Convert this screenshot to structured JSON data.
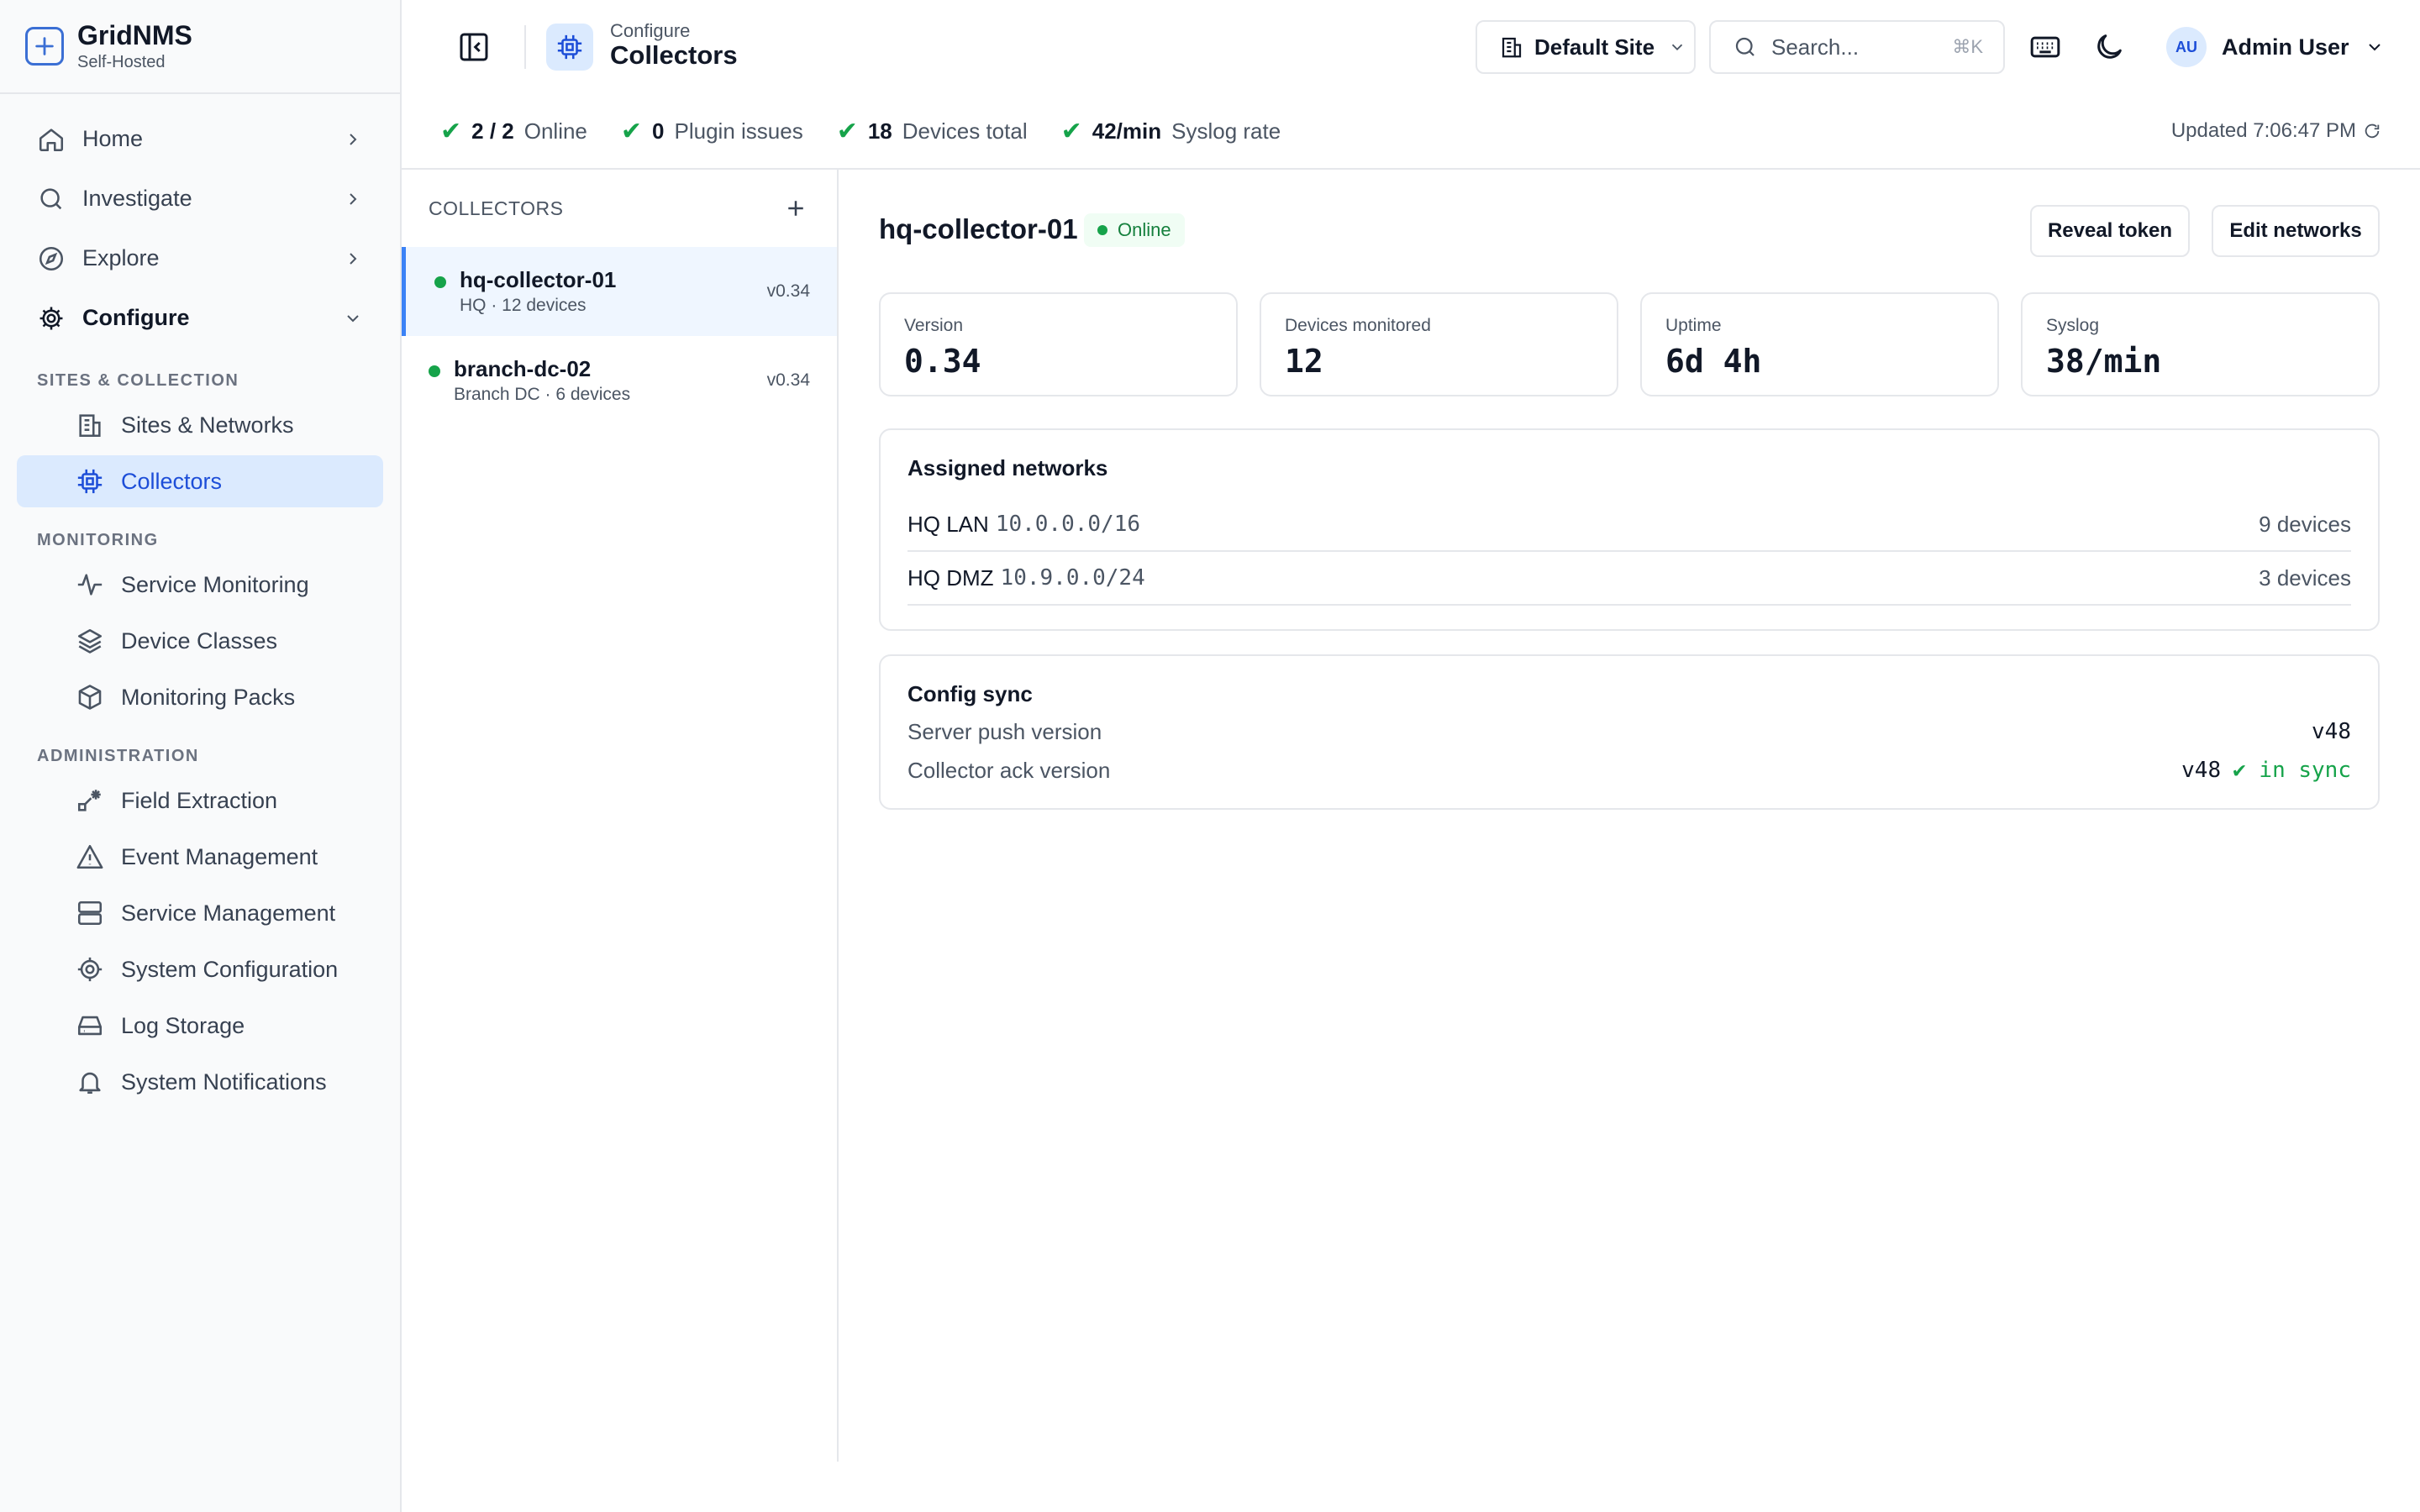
{
  "brand": {
    "name": "GridNMS",
    "subtitle": "Self-Hosted"
  },
  "nav": {
    "top": [
      {
        "label": "Home"
      },
      {
        "label": "Investigate"
      },
      {
        "label": "Explore"
      },
      {
        "label": "Configure"
      }
    ],
    "sections": [
      {
        "title": "SITES & COLLECTION",
        "items": [
          {
            "label": "Sites & Networks"
          },
          {
            "label": "Collectors"
          }
        ]
      },
      {
        "title": "MONITORING",
        "items": [
          {
            "label": "Service Monitoring"
          },
          {
            "label": "Device Classes"
          },
          {
            "label": "Monitoring Packs"
          }
        ]
      },
      {
        "title": "ADMINISTRATION",
        "items": [
          {
            "label": "Field Extraction"
          },
          {
            "label": "Event Management"
          },
          {
            "label": "Service Management"
          },
          {
            "label": "System Configuration"
          },
          {
            "label": "Log Storage"
          },
          {
            "label": "System Notifications"
          }
        ]
      }
    ]
  },
  "header": {
    "breadcrumb_parent": "Configure",
    "page_title": "Collectors",
    "site_selector": "Default Site",
    "search_placeholder": "Search...",
    "search_shortcut": "⌘K",
    "user_initials": "AU",
    "user_name": "Admin User"
  },
  "status": {
    "items": [
      {
        "value": "2 / 2",
        "label": "Online"
      },
      {
        "value": "0",
        "label": "Plugin issues"
      },
      {
        "value": "18",
        "label": "Devices total"
      },
      {
        "value": "42/min",
        "label": "Syslog rate"
      }
    ],
    "updated": "Updated 7:06:47 PM"
  },
  "collectors_list": {
    "title": "COLLECTORS",
    "items": [
      {
        "name": "hq-collector-01",
        "meta": "HQ · 12 devices",
        "version": "v0.34"
      },
      {
        "name": "branch-dc-02",
        "meta": "Branch DC · 6 devices",
        "version": "v0.34"
      }
    ]
  },
  "detail": {
    "name": "hq-collector-01",
    "status": "Online",
    "reveal_token_label": "Reveal token",
    "edit_networks_label": "Edit networks",
    "cards": [
      {
        "label": "Version",
        "value": "0.34"
      },
      {
        "label": "Devices monitored",
        "value": "12"
      },
      {
        "label": "Uptime",
        "value": "6d 4h"
      },
      {
        "label": "Syslog",
        "value": "38/min"
      }
    ],
    "networks": {
      "title": "Assigned networks",
      "rows": [
        {
          "name": "HQ LAN",
          "cidr": "10.0.0.0/16",
          "devices": "9 devices"
        },
        {
          "name": "HQ DMZ",
          "cidr": "10.9.0.0/24",
          "devices": "3 devices"
        }
      ]
    },
    "config_sync": {
      "title": "Config sync",
      "server_push_label": "Server push version",
      "server_push_value": "v48",
      "collector_ack_label": "Collector ack version",
      "collector_ack_value": "v48",
      "sync_state": "✔ in sync"
    }
  },
  "colors": {
    "accent": "#1d4ed8",
    "active_bg": "#dbeafe",
    "success": "#16a34a"
  }
}
